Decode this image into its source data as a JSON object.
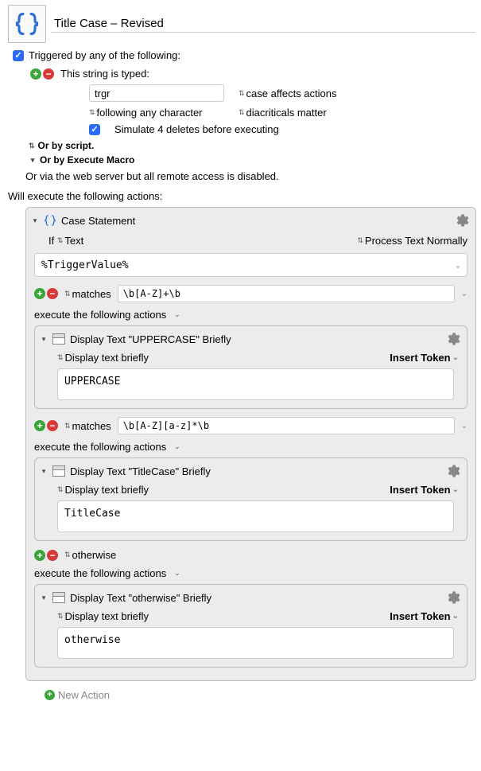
{
  "header": {
    "title": "Title Case – Revised"
  },
  "triggers": {
    "heading": "Triggered by any of the following:",
    "stringTyped": {
      "label": "This string is typed:",
      "value": "trgr",
      "opt1": "case affects actions",
      "opt2": "following any character",
      "opt3": "diacriticals matter",
      "deletes": "Simulate 4 deletes before executing"
    },
    "orScript": "Or by script.",
    "orExecute": "Or by Execute Macro",
    "webServer": "Or via the web server but all remote access is disabled."
  },
  "actionsLabel": "Will execute the following actions:",
  "caseAction": {
    "title": "Case Statement",
    "ifLabel": "If",
    "ifSel": "Text",
    "processSel": "Process Text Normally",
    "triggerValue": "%TriggerValue%",
    "branches": [
      {
        "matchLabel": "matches",
        "pattern": "\\b[A-Z]+\\b",
        "execLabel": "execute the following actions",
        "sub": {
          "title": "Display Text \"UPPERCASE\" Briefly",
          "displaySel": "Display text briefly",
          "tokenBtn": "Insert Token",
          "text": "UPPERCASE"
        }
      },
      {
        "matchLabel": "matches",
        "pattern": "\\b[A-Z][a-z]*\\b",
        "execLabel": "execute the following actions",
        "sub": {
          "title": "Display Text \"TitleCase\" Briefly",
          "displaySel": "Display text briefly",
          "tokenBtn": "Insert Token",
          "text": "TitleCase"
        }
      },
      {
        "matchLabel": "otherwise",
        "pattern": "",
        "execLabel": "execute the following actions",
        "sub": {
          "title": "Display Text \"otherwise\" Briefly",
          "displaySel": "Display text briefly",
          "tokenBtn": "Insert Token",
          "text": "otherwise"
        }
      }
    ]
  },
  "newAction": "New Action"
}
